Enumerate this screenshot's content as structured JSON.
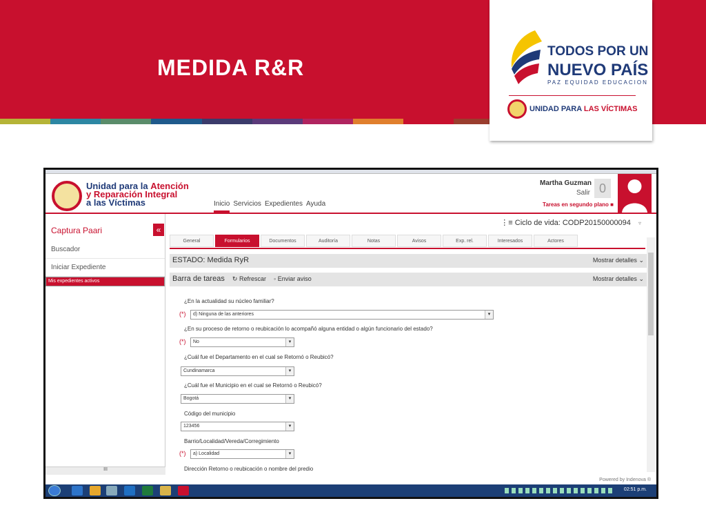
{
  "slide": {
    "title": "MEDIDA R&R",
    "brand_color": "#c8102e",
    "stripe_colors": [
      "#b5b437",
      "#2c87a3",
      "#5a8c6a",
      "#1f5a8c",
      "#3b3b6b",
      "#5b3a7a",
      "#b0245f",
      "#e07f2d",
      "#c8102e",
      "#9a3d2e",
      "#c8102e",
      "#c8102e",
      "#c8102e",
      "#c8102e"
    ]
  },
  "logo": {
    "line1": "TODOS POR UN",
    "line2": "NUEVO PAÍS",
    "line3": "PAZ  EQUIDAD  EDUCACION",
    "unidad_prefix": "UNIDAD PARA ",
    "unidad_suffix": "LAS VÍCTIMAS"
  },
  "app": {
    "org_line1_a": "Unidad para la ",
    "org_line1_b": "Atención",
    "org_line2": "y Reparación Integral",
    "org_line3": "a las Víctimas",
    "nav": [
      "Inicio",
      "Servicios",
      "Expedientes",
      "Ayuda"
    ],
    "user_name": "Martha Guzman",
    "logout": "Salir",
    "counter": "0",
    "background_tasks": "Tareas en segundo plano",
    "sidebar": {
      "title": "Captura Paari",
      "collapse": "«",
      "items": [
        "Buscador",
        "Iniciar Expediente",
        "Mis expedientes activos"
      ]
    },
    "lifecycle": "Ciclo de vida: CODP20150000094",
    "tabs": [
      "General",
      "Formularios",
      "Documentos",
      "Auditoría",
      "Notas",
      "Avisos",
      "Exp. rel.",
      "Interesados",
      "Actores"
    ],
    "estado": "ESTADO: Medida RyR",
    "show_details": "Mostrar detalles",
    "barra": "Barra de tareas",
    "refrescar": "Refrescar",
    "enviar_aviso": "Enviar aviso",
    "form": {
      "q1": "¿En la actualidad su núcleo familiar?",
      "a1": "d) Ninguna de las anteriores",
      "q2": "¿En su proceso de retorno o reubicación lo acompañó alguna entidad o algún funcionario del estado?",
      "a2": "No",
      "q3": "¿Cuál fue el Departamento en el cual se Retornó o Reubicó?",
      "a3": "Cundinamarca",
      "q4": "¿Cuál fue el Municipio en el cual se Retornó o Reubicó?",
      "a4": "Bogotá",
      "q5": "Código del municipio",
      "a5": "123456",
      "q6": "Barrio/Localidad/Vereda/Corregimiento",
      "a6": "a) Localidad",
      "q7": "Dirección Retorno o reubicación o nombre del predio",
      "required": "(*)"
    },
    "powered": "Powered by Indenova ®",
    "clock": "02:51 p.m.",
    "hscroll_label": "III"
  }
}
